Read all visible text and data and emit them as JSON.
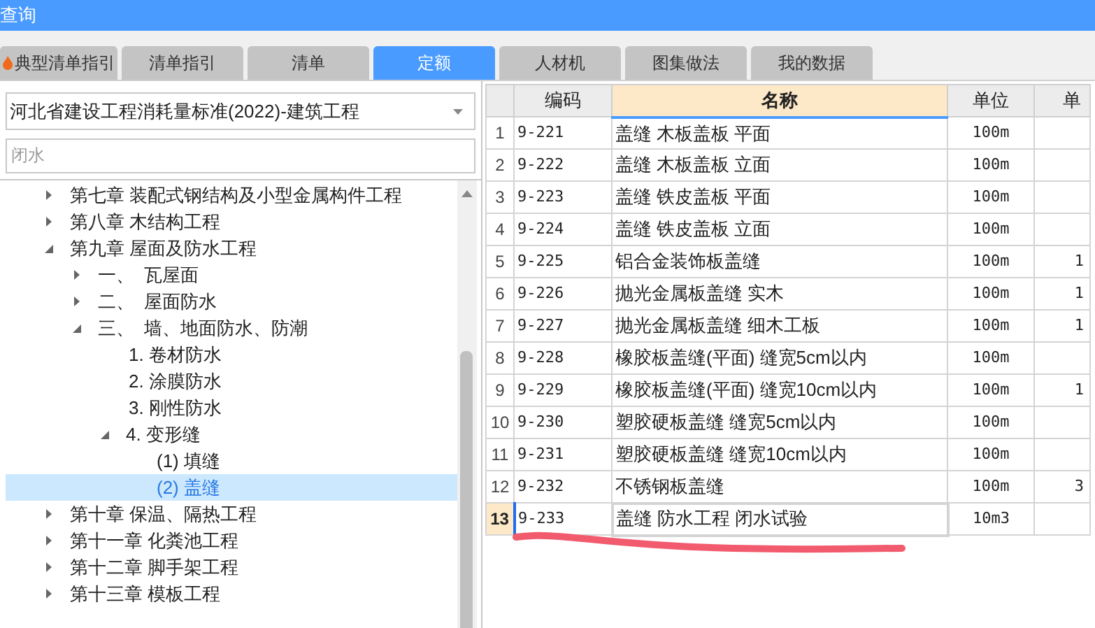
{
  "window": {
    "title": "查询"
  },
  "tabs": [
    {
      "label": "典型清单指引",
      "selected": false,
      "hot": true
    },
    {
      "label": "清单指引",
      "selected": false
    },
    {
      "label": "清单",
      "selected": false
    },
    {
      "label": "定额",
      "selected": true
    },
    {
      "label": "人材机",
      "selected": false
    },
    {
      "label": "图集做法",
      "selected": false
    },
    {
      "label": "我的数据",
      "selected": false
    }
  ],
  "library_select": {
    "value": "河北省建设工程消耗量标准(2022)-建筑工程"
  },
  "search": {
    "value": "闭水"
  },
  "tree": [
    {
      "label": "第七章 装配式钢结构及小型金属构件工程",
      "expanded": false,
      "selected": false
    },
    {
      "label": "第八章 木结构工程",
      "expanded": false,
      "selected": false
    },
    {
      "label": "第九章 屋面及防水工程",
      "expanded": true,
      "selected": false,
      "children": [
        {
          "label": "一、  瓦屋面",
          "expanded": false,
          "selected": false
        },
        {
          "label": "二、  屋面防水",
          "expanded": false,
          "selected": false
        },
        {
          "label": "三、  墙、地面防水、防潮",
          "expanded": true,
          "selected": false,
          "children": [
            {
              "label": "1. 卷材防水",
              "selected": false
            },
            {
              "label": "2. 涂膜防水",
              "selected": false
            },
            {
              "label": "3. 刚性防水",
              "selected": false
            },
            {
              "label": "4. 变形缝",
              "expanded": true,
              "selected": false,
              "children": [
                {
                  "label": "(1) 填缝",
                  "selected": false
                },
                {
                  "label": "(2) 盖缝",
                  "selected": true
                }
              ]
            }
          ]
        }
      ]
    },
    {
      "label": "第十章 保温、隔热工程",
      "expanded": false,
      "selected": false
    },
    {
      "label": "第十一章 化粪池工程",
      "expanded": false,
      "selected": false
    },
    {
      "label": "第十二章 脚手架工程",
      "expanded": false,
      "selected": false
    },
    {
      "label": "第十三章 模板工程",
      "expanded": false,
      "selected": false
    }
  ],
  "table": {
    "columns": [
      "编码",
      "名称",
      "单位",
      "单"
    ],
    "rows": [
      {
        "index": "1",
        "code": "9-221",
        "name": "盖缝 木板盖板 平面",
        "unit": "100m",
        "selected": false
      },
      {
        "index": "2",
        "code": "9-222",
        "name": "盖缝 木板盖板 立面",
        "unit": "100m",
        "selected": false
      },
      {
        "index": "3",
        "code": "9-223",
        "name": "盖缝 铁皮盖板 平面",
        "unit": "100m",
        "selected": false
      },
      {
        "index": "4",
        "code": "9-224",
        "name": "盖缝 铁皮盖板 立面",
        "unit": "100m",
        "selected": false
      },
      {
        "index": "5",
        "code": "9-225",
        "name": "铝合金装饰板盖缝",
        "unit": "100m",
        "column_5": "1",
        "selected": false
      },
      {
        "index": "6",
        "code": "9-226",
        "name": "抛光金属板盖缝 实木",
        "unit": "100m",
        "column_5": "1",
        "selected": false
      },
      {
        "index": "7",
        "code": "9-227",
        "name": "抛光金属板盖缝 细木工板",
        "unit": "100m",
        "column_5": "1",
        "selected": false
      },
      {
        "index": "8",
        "code": "9-228",
        "name": "橡胶板盖缝(平面) 缝宽5cm以内",
        "unit": "100m",
        "selected": false
      },
      {
        "index": "9",
        "code": "9-229",
        "name": "橡胶板盖缝(平面) 缝宽10cm以内",
        "unit": "100m",
        "column_5": "1",
        "selected": false
      },
      {
        "index": "10",
        "code": "9-230",
        "name": "塑胶硬板盖缝 缝宽5cm以内",
        "unit": "100m",
        "selected": false
      },
      {
        "index": "11",
        "code": "9-231",
        "name": "塑胶硬板盖缝 缝宽10cm以内",
        "unit": "100m",
        "selected": false
      },
      {
        "index": "12",
        "code": "9-232",
        "name": "不锈钢板盖缝",
        "unit": "100m",
        "column_5": "3",
        "selected": false
      },
      {
        "index": "13",
        "code": "9-233",
        "name": "盖缝 防水工程 闭水试验",
        "unit": "10m3",
        "selected": true
      }
    ]
  }
}
